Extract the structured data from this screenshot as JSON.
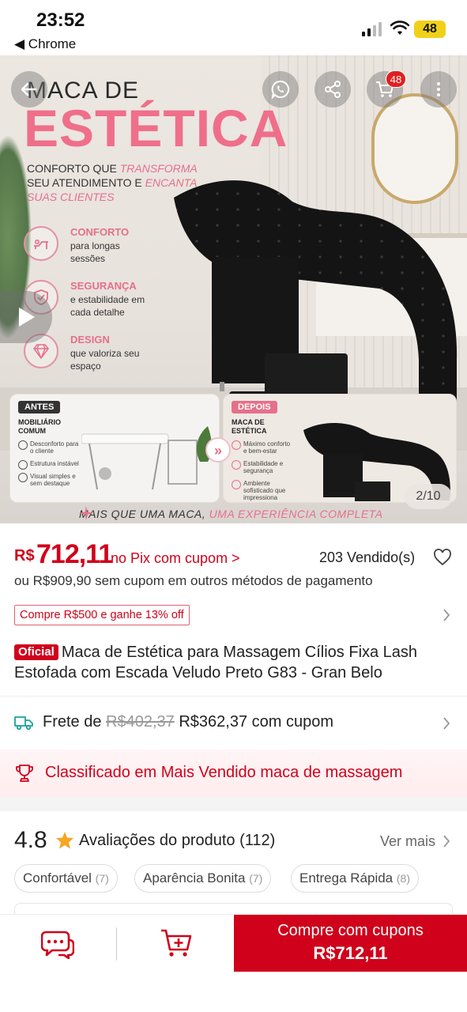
{
  "status_bar": {
    "time": "23:52",
    "back_app": "◀ Chrome",
    "battery": "48"
  },
  "hero": {
    "title_line1": "MACA DE",
    "title_line2": "ESTÉTICA",
    "subtitle_a": "CONFORTO QUE ",
    "subtitle_b": "TRANSFORMA",
    "subtitle_c": "SEU ATENDIMENTO E ",
    "subtitle_d": "ENCANTA",
    "subtitle_e": "SUAS CLIENTES",
    "features": [
      {
        "title": "CONFORTO",
        "desc": "para longas sessões",
        "icon": "lounger-icon"
      },
      {
        "title": "SEGURANÇA",
        "desc": "e estabilidade em cada detalhe",
        "icon": "shield-icon"
      },
      {
        "title": "DESIGN",
        "desc": "que valoriza seu espaço",
        "icon": "diamond-icon"
      }
    ],
    "before": {
      "tag": "ANTES",
      "heading": "MOBILIÁRIO COMUM",
      "items": [
        "Desconforto para o cliente",
        "Estrutura instável",
        "Visual simples e sem destaque"
      ]
    },
    "after": {
      "tag": "DEPOIS",
      "heading": "MACA DE ESTÉTICA",
      "items": [
        "Máximo conforto e bem-estar",
        "Estabilidade e segurança",
        "Ambiente sofisticado que impressiona"
      ]
    },
    "tagline_a": "MAIS QUE UMA MACA, ",
    "tagline_b": "UMA EXPERIÊNCIA COMPLETA",
    "cart_badge": "48",
    "image_counter": "2/10"
  },
  "price": {
    "currency": "R$",
    "value": "712,11",
    "pix_label": "no Pix com cupom >",
    "sold": "203 Vendido(s)",
    "alt_price": "ou R$909,90 sem cupom em outros métodos de pagamento"
  },
  "coupon": {
    "label": "Compre R$500 e ganhe 13% off"
  },
  "product": {
    "badge": "Oficial",
    "title": "Maca de Estética para Massagem Cílios Fixa Lash Estofada com Escada Veludo Preto G83 - Gran Belo"
  },
  "shipping": {
    "label": "Frete de ",
    "old_price": "R$402,37",
    "new_price": " R$362,37 com cupom"
  },
  "ranking": {
    "text": "Classificado em Mais Vendido maca de massagem"
  },
  "reviews": {
    "score": "4.8",
    "label": "Avaliações do produto",
    "count": "(112)",
    "see_more": "Ver mais",
    "chips": [
      {
        "label": "Confortável",
        "count": "(7)"
      },
      {
        "label": "Aparência Bonita",
        "count": "(7)"
      },
      {
        "label": "Entrega Rápida",
        "count": "(8)"
      }
    ]
  },
  "bottom_bar": {
    "buy_line1": "Compre com cupons",
    "buy_line2": "R$712,11"
  },
  "colors": {
    "brand_red": "#d0021b",
    "hero_pink": "#ef6f8a",
    "star": "#f5a623"
  }
}
